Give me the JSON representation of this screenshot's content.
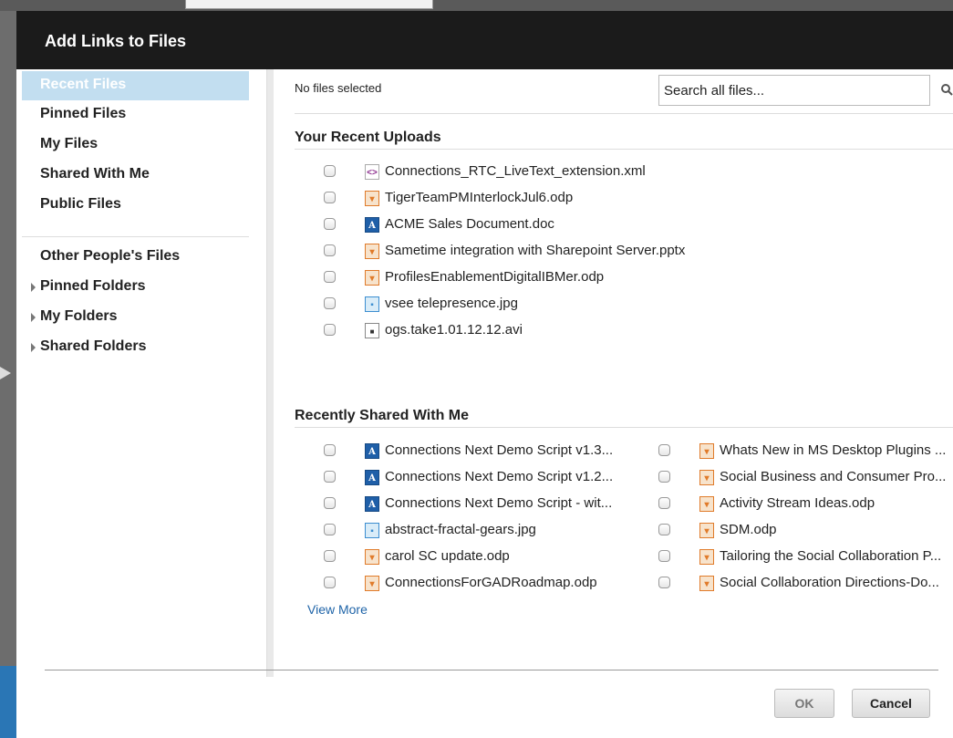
{
  "dialog": {
    "title": "Add Links to Files"
  },
  "sidebar": {
    "items": [
      {
        "label": "Recent Files",
        "active": true
      },
      {
        "label": "Pinned Files"
      },
      {
        "label": "My Files"
      },
      {
        "label": "Shared With Me"
      },
      {
        "label": "Public Files"
      }
    ],
    "people": [
      {
        "label": "Other People's Files",
        "caret": false
      },
      {
        "label": "Pinned Folders",
        "caret": true
      },
      {
        "label": "My Folders",
        "caret": true
      },
      {
        "label": "Shared Folders",
        "caret": true
      }
    ]
  },
  "main": {
    "status": "No files selected",
    "search": {
      "value": "Search all files..."
    },
    "recent_uploads": {
      "title": "Your Recent Uploads",
      "files": [
        {
          "name": "Connections_RTC_LiveText_extension.xml",
          "type": "xml"
        },
        {
          "name": "TigerTeamPMInterlockJul6.odp",
          "type": "odp"
        },
        {
          "name": "ACME Sales Document.doc",
          "type": "doc"
        },
        {
          "name": "Sametime integration with Sharepoint Server.pptx",
          "type": "pptx"
        },
        {
          "name": "ProfilesEnablementDigitalIBMer.odp",
          "type": "odp"
        },
        {
          "name": "vsee telepresence.jpg",
          "type": "jpg"
        },
        {
          "name": "ogs.take1.01.12.12.avi",
          "type": "avi"
        }
      ]
    },
    "shared_with_me": {
      "title": "Recently Shared With Me",
      "left": [
        {
          "name": "Connections Next Demo Script v1.3...",
          "type": "doc"
        },
        {
          "name": "Connections Next Demo Script v1.2...",
          "type": "doc"
        },
        {
          "name": "Connections Next Demo Script - wit...",
          "type": "doc"
        },
        {
          "name": "abstract-fractal-gears.jpg",
          "type": "jpg"
        },
        {
          "name": "carol SC update.odp",
          "type": "odp"
        },
        {
          "name": "ConnectionsForGADRoadmap.odp",
          "type": "odp"
        }
      ],
      "right": [
        {
          "name": "Whats New in MS Desktop Plugins ...",
          "type": "odp"
        },
        {
          "name": "Social Business and Consumer Pro...",
          "type": "odp"
        },
        {
          "name": "Activity Stream Ideas.odp",
          "type": "odp"
        },
        {
          "name": "SDM.odp",
          "type": "odp"
        },
        {
          "name": "Tailoring the Social Collaboration P...",
          "type": "odp"
        },
        {
          "name": "Social Collaboration Directions-Do...",
          "type": "odp"
        }
      ],
      "view_more": "View More"
    }
  },
  "footer": {
    "ok": "OK",
    "cancel": "Cancel"
  }
}
